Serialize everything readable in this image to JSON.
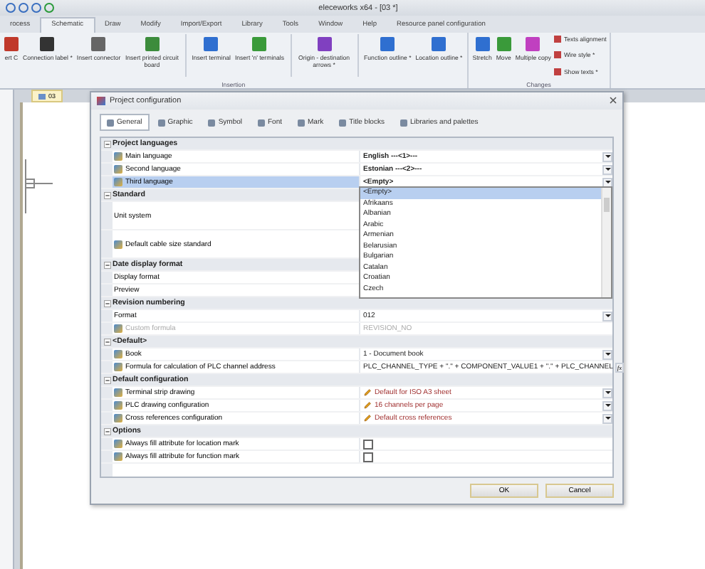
{
  "window": {
    "title": "eleceworks x64 - [03 *]"
  },
  "menu_tabs": [
    {
      "label": "rocess",
      "selected": false
    },
    {
      "label": "Schematic",
      "selected": true
    },
    {
      "label": "Draw",
      "selected": false
    },
    {
      "label": "Modify",
      "selected": false
    },
    {
      "label": "Import/Export",
      "selected": false
    },
    {
      "label": "Library",
      "selected": false
    },
    {
      "label": "Tools",
      "selected": false
    },
    {
      "label": "Window",
      "selected": false
    },
    {
      "label": "Help",
      "selected": false
    },
    {
      "label": "Resource panel configuration",
      "selected": false
    }
  ],
  "ribbon": {
    "groups": [
      {
        "label": "Insertion",
        "buttons": [
          {
            "kind": "large",
            "label": "ert C"
          },
          {
            "kind": "large",
            "label": "Connection label *"
          },
          {
            "kind": "large",
            "label": "Insert connector"
          },
          {
            "kind": "large",
            "label": "Insert printed circuit board"
          },
          {
            "kind": "separator"
          },
          {
            "kind": "large",
            "label": "Insert terminal"
          },
          {
            "kind": "large",
            "label": "Insert 'n' terminals"
          },
          {
            "kind": "separator"
          },
          {
            "kind": "large",
            "label": "Origin - destination arrows *"
          },
          {
            "kind": "separator"
          },
          {
            "kind": "large",
            "label": "Function outline *"
          },
          {
            "kind": "large",
            "label": "Location outline *"
          }
        ]
      },
      {
        "label": "Changes",
        "buttons": [
          {
            "kind": "large",
            "label": "Stretch"
          },
          {
            "kind": "large",
            "label": "Move"
          },
          {
            "kind": "large",
            "label": "Multiple copy"
          },
          {
            "kind": "small",
            "label": "Texts alignment"
          },
          {
            "kind": "small",
            "label": "Wire style *"
          },
          {
            "kind": "small",
            "label": "Show texts *"
          }
        ]
      }
    ]
  },
  "document_tab": {
    "label": "03"
  },
  "dialog": {
    "title": "Project configuration",
    "tabs": [
      {
        "label": "General",
        "selected": true
      },
      {
        "label": "Graphic",
        "selected": false
      },
      {
        "label": "Symbol",
        "selected": false
      },
      {
        "label": "Font",
        "selected": false
      },
      {
        "label": "Mark",
        "selected": false
      },
      {
        "label": "Title blocks",
        "selected": false
      },
      {
        "label": "Libraries and palettes",
        "selected": false
      }
    ],
    "sections": [
      {
        "title": "Project languages",
        "expanded": true,
        "rows": [
          {
            "label": "Main language",
            "value": "English ---<1>---",
            "kind": "dropdown",
            "has_icon": true,
            "bold": true,
            "selected": false
          },
          {
            "label": "Second language",
            "value": "Estonian ---<2>---",
            "kind": "dropdown",
            "has_icon": true,
            "bold": true,
            "selected": false
          },
          {
            "label": "Third language",
            "value": "<Empty>",
            "kind": "dropdown",
            "has_icon": true,
            "bold": true,
            "selected": true
          }
        ]
      },
      {
        "title": "Standard",
        "expanded": true,
        "rows": [
          {
            "label": "Unit system",
            "kind": "plain",
            "selected": false,
            "tall": true
          },
          {
            "label": "Default cable size standard",
            "kind": "plain",
            "has_icon": true,
            "selected": false,
            "tall": true
          }
        ]
      },
      {
        "title": "Date display format",
        "expanded": true,
        "rows": [
          {
            "label": "Display format",
            "kind": "plain",
            "selected": false
          },
          {
            "label": "Preview",
            "kind": "plain",
            "selected": false
          }
        ]
      },
      {
        "title": "Revision numbering",
        "expanded": true,
        "rows": [
          {
            "label": "Format",
            "value": "012",
            "kind": "dropdown",
            "selected": false
          },
          {
            "label": "Custom formula",
            "value": "REVISION_NO",
            "kind": "text",
            "has_icon": true,
            "selected": false,
            "disabled": true
          }
        ]
      },
      {
        "title": "<Default>",
        "expanded": true,
        "rows": [
          {
            "label": "Book",
            "value": "1 - Document book",
            "kind": "dropdown",
            "has_icon": true,
            "selected": false
          },
          {
            "label": "Formula for calculation of PLC channel address",
            "value": "PLC_CHANNEL_TYPE + \".\" + COMPONENT_VALUE1 + \".\" + PLC_CHANNEL",
            "kind": "formula",
            "button_label": "fx",
            "has_icon": true,
            "selected": false
          }
        ]
      },
      {
        "title": "Default configuration",
        "expanded": true,
        "rows": [
          {
            "label": "Terminal strip drawing",
            "value": "Default for ISO A3 sheet",
            "kind": "config",
            "has_icon": true,
            "selected": false
          },
          {
            "label": "PLC drawing configuration",
            "value": "16 channels per page",
            "kind": "config",
            "has_icon": true,
            "selected": false
          },
          {
            "label": "Cross references configuration",
            "value": "Default cross references",
            "kind": "config",
            "has_icon": true,
            "selected": false
          }
        ]
      },
      {
        "title": "Options",
        "expanded": true,
        "rows": [
          {
            "label": "Always fill attribute for location mark",
            "kind": "checkbox",
            "checked": false,
            "has_icon": true,
            "selected": false
          },
          {
            "label": "Always fill attribute for function mark",
            "kind": "checkbox",
            "checked": false,
            "has_icon": true,
            "selected": false
          }
        ]
      }
    ],
    "dropdown": {
      "items": [
        {
          "label": "<Empty>",
          "selected": true
        },
        {
          "label": "Afrikaans",
          "selected": false
        },
        {
          "label": "Albanian",
          "selected": false
        },
        {
          "label": "Arabic",
          "selected": false
        },
        {
          "label": "Armenian",
          "selected": false
        },
        {
          "label": "Belarusian",
          "selected": false
        },
        {
          "label": "Bulgarian",
          "selected": false
        },
        {
          "label": "Catalan",
          "selected": false
        },
        {
          "label": "Croatian",
          "selected": false
        },
        {
          "label": "Czech",
          "selected": false
        }
      ]
    },
    "buttons": [
      {
        "label": "OK"
      },
      {
        "label": "Cancel"
      }
    ]
  }
}
